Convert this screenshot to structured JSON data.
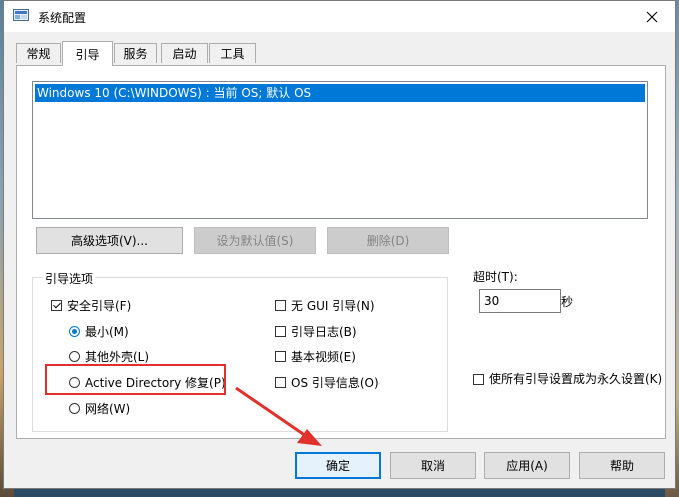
{
  "window": {
    "title": "系统配置",
    "close_glyph": "✕"
  },
  "tabs": [
    {
      "label": "常规",
      "active": false
    },
    {
      "label": "引导",
      "active": true
    },
    {
      "label": "服务",
      "active": false
    },
    {
      "label": "启动",
      "active": false
    },
    {
      "label": "工具",
      "active": false
    }
  ],
  "boot_list": {
    "items": [
      "Windows 10 (C:\\WINDOWS) : 当前 OS; 默认 OS"
    ],
    "selected_index": 0
  },
  "boot_buttons": {
    "advanced": "高级选项(V)...",
    "set_default": "设为默认值(S)",
    "delete": "删除(D)"
  },
  "boot_options": {
    "title": "引导选项",
    "safe_boot": {
      "label": "安全引导(F)",
      "checked": true
    },
    "radios": [
      {
        "label": "最小(M)",
        "checked": true
      },
      {
        "label": "其他外壳(L)",
        "checked": false
      },
      {
        "label": "Active Directory 修复(P)",
        "checked": false
      },
      {
        "label": "网络(W)",
        "checked": false
      }
    ],
    "checks": [
      {
        "label": "无 GUI 引导(N)",
        "checked": false
      },
      {
        "label": "引导日志(B)",
        "checked": false
      },
      {
        "label": "基本视频(E)",
        "checked": false
      },
      {
        "label": "OS 引导信息(O)",
        "checked": false
      }
    ]
  },
  "timeout": {
    "label": "超时(T):",
    "value": "30",
    "unit": "秒"
  },
  "permanent": {
    "label": "使所有引导设置成为永久设置(K)",
    "checked": false
  },
  "footer": {
    "ok": "确定",
    "cancel": "取消",
    "apply": "应用(A)",
    "help": "帮助"
  },
  "annotation": {
    "highlight_color": "#e0312b"
  }
}
